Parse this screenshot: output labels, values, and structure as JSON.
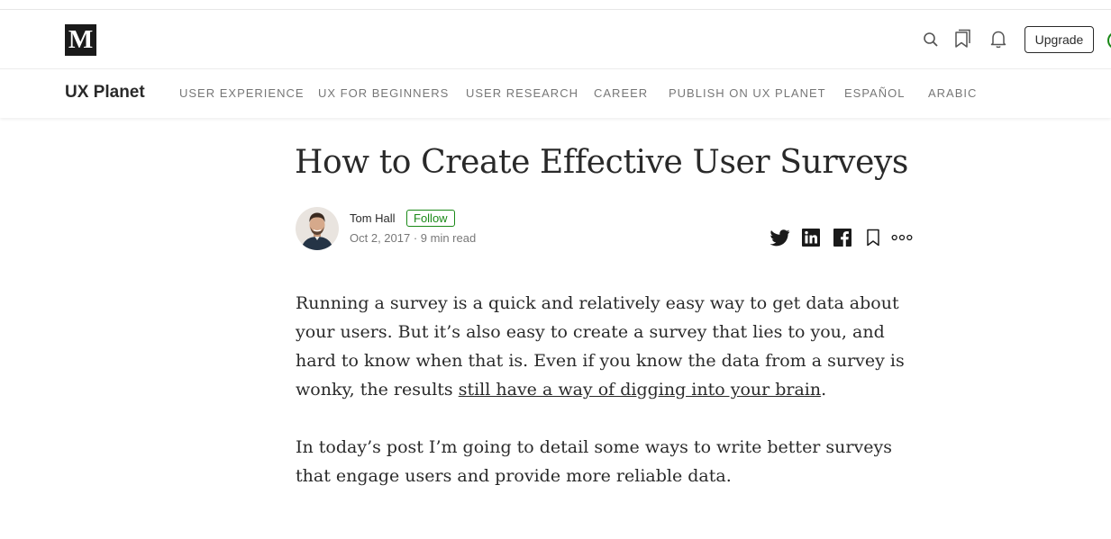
{
  "topbar": {
    "logo_text": "M",
    "upgrade_label": "Upgrade"
  },
  "publication": {
    "name": "UX Planet",
    "nav": [
      "USER EXPERIENCE",
      "UX FOR BEGINNERS",
      "USER RESEARCH",
      "CAREER",
      "PUBLISH ON UX PLANET",
      "ESPAÑOL",
      "ARABIC"
    ]
  },
  "article": {
    "title": "How to Create Effective User Surveys",
    "author": "Tom Hall",
    "follow_label": "Follow",
    "date": "Oct 2, 2017",
    "read_time": "9 min read",
    "meta_separator": " · ",
    "paragraph1": {
      "text": "Running a survey is a quick and relatively easy way to get data about your users. But it’s also easy to create a survey that lies to you, and hard to know when that is. Even if you know the data from a survey is wonky, the results ",
      "link": "still have a way of digging into your brain",
      "end": "."
    },
    "paragraph2": "In today’s post I’m going to detail some ways to write better surveys that engage users and provide more reliable data."
  },
  "colors": {
    "accent_green": "#1a8917",
    "text_primary": "rgba(0,0,0,0.84)",
    "text_secondary": "rgba(0,0,0,0.54)"
  },
  "icons": [
    "medium-logo",
    "search-icon",
    "bookmarks-icon",
    "bell-icon",
    "twitter-icon",
    "linkedin-icon",
    "facebook-icon",
    "bookmark-icon",
    "more-icon"
  ]
}
